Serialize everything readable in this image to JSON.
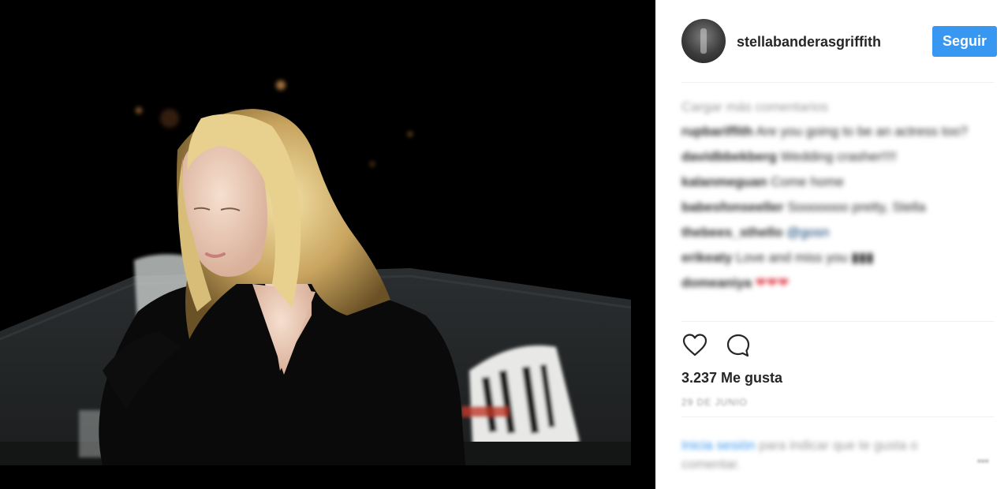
{
  "post": {
    "image_description_icon": "photo-of-person-at-night"
  },
  "header": {
    "username": "stellabanderasgriffith",
    "follow_label": "Seguir",
    "avatar_icon": "profile-avatar"
  },
  "comments": {
    "load_more": "Cargar más comentarios",
    "items": [
      {
        "user": "rupbariffith",
        "text": "Are you going to be an actress too?",
        "mention": "",
        "emoji": ""
      },
      {
        "user": "davidbbekberg",
        "text": "Wedding crasher!!!!",
        "mention": "",
        "emoji": ""
      },
      {
        "user": "kalanmeguan",
        "text": "Come home",
        "mention": "",
        "emoji": ""
      },
      {
        "user": "babesfonseeller",
        "text": "Sooooooo pretty, Stella",
        "mention": "",
        "emoji": ""
      },
      {
        "user": "thebees_sthello",
        "text": "",
        "mention": "@gosn",
        "emoji": ""
      },
      {
        "user": "erikeaty",
        "text": "Love and miss you",
        "mention": "",
        "emoji": "▮▮▮"
      },
      {
        "user": "domeaniya",
        "text": "",
        "mention": "",
        "emoji": "❤❤❤"
      }
    ]
  },
  "actions": {
    "like_icon": "heart-icon",
    "comment_icon": "comment-bubble-icon"
  },
  "likes": "3.237 Me gusta",
  "date": "29 DE JUNIO",
  "footer": {
    "login_link": "Inicia sesión",
    "login_rest": " para indicar que te gusta o comentar.",
    "more": "•••"
  },
  "colors": {
    "accent": "#3897f0",
    "text": "#262626",
    "muted": "#999999",
    "divider": "#efefef",
    "photo_bg": "#000000"
  }
}
